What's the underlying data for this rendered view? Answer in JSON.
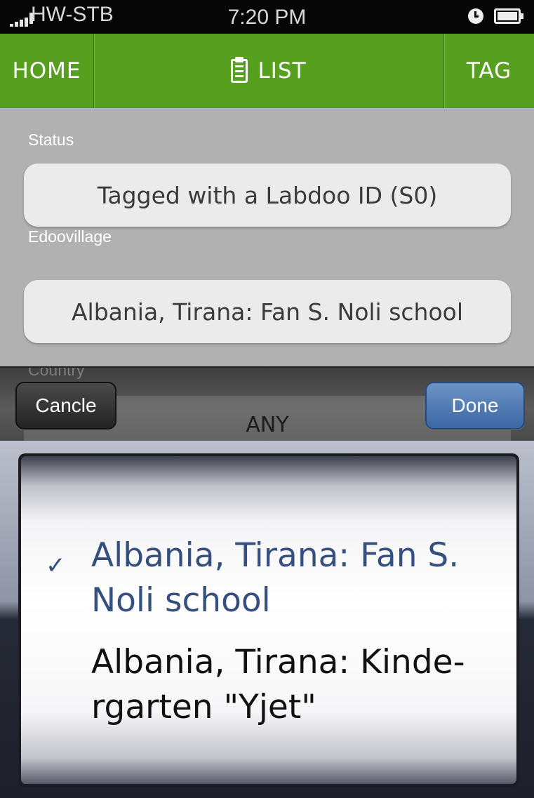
{
  "status_bar": {
    "carrier": "HW-STB",
    "time": "7:20 PM"
  },
  "nav": {
    "home": "HOME",
    "list": "LIST",
    "tag": "TAG"
  },
  "form": {
    "status_label": "Status",
    "status_value": "Tagged with a Labdoo ID (S0)",
    "edoovillage_label": "Edoovillage",
    "edoovillage_value": "Albania, Tirana: Fan S. Noli school",
    "country_label": "Country",
    "country_value": "ANY"
  },
  "toolbar": {
    "cancel": "Cancle",
    "done": "Done"
  },
  "picker": {
    "options": [
      {
        "label": "Albania, Tirana: Fan S. Noli school",
        "selected": true
      },
      {
        "label": "Albania, Tirana: Kinde-rgarten \"Yjet\"",
        "selected": false
      }
    ]
  },
  "colors": {
    "nav_green": "#57a01f",
    "selected_text": "#35507f",
    "done_blue": "#4a74b0"
  }
}
